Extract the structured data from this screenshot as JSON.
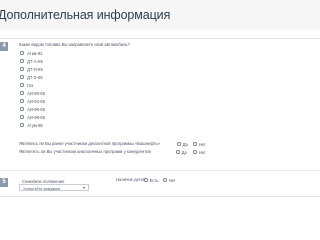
{
  "page": {
    "title": "Дополнительная информация"
  },
  "section1": {
    "step": "4",
    "question": "Какие видом топлива Вы заправляете свой автомобиль?",
    "options": [
      "Аткм-92",
      "ДТ-А-К5",
      "ДТ-Л-К5",
      "ДТ-З-К5",
      "Газ",
      "АИ-80-К5",
      "АИ-92-К5",
      "АИ-95-К5",
      "АИ-98-К5",
      "Атум-95"
    ],
    "yes_no_questions": [
      {
        "question": "Являлись ли Вы ранее участником дисконтной программы «Башнефть»",
        "yes": "Да",
        "no": "Нет"
      },
      {
        "question": "Являетесь ли Вы участником аналогичных программ у конкурентов",
        "yes": "Да",
        "no": "Нет"
      }
    ]
  },
  "section2": {
    "step": "5",
    "marital_label": "Семейное положение",
    "marital_value": "Холост/Не замужем",
    "children_label": "Наличие детей",
    "children_yes": "Есть",
    "children_no": "Нет"
  },
  "colors": {
    "header_bg": "#f6f6f6",
    "step_badge_bg": "#8b99ab",
    "text": "#4a5567",
    "title": "#2f3e52"
  }
}
